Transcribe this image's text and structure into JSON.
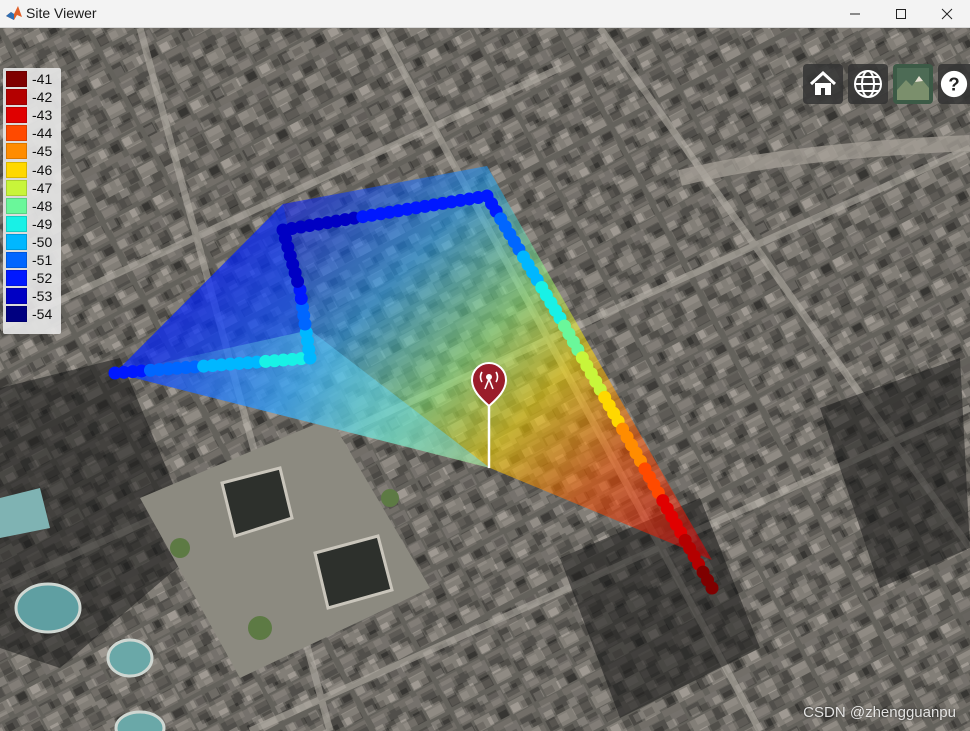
{
  "window": {
    "title": "Site Viewer"
  },
  "legend": {
    "items": [
      {
        "label": "-41",
        "color": "#7f0000"
      },
      {
        "label": "-42",
        "color": "#b40000"
      },
      {
        "label": "-43",
        "color": "#e00000"
      },
      {
        "label": "-44",
        "color": "#ff4a00"
      },
      {
        "label": "-45",
        "color": "#ff8c00"
      },
      {
        "label": "-46",
        "color": "#ffd800"
      },
      {
        "label": "-47",
        "color": "#c8f53a"
      },
      {
        "label": "-48",
        "color": "#6af79a"
      },
      {
        "label": "-49",
        "color": "#18f1e6"
      },
      {
        "label": "-50",
        "color": "#00b7ff"
      },
      {
        "label": "-51",
        "color": "#0066ff"
      },
      {
        "label": "-52",
        "color": "#0018ff"
      },
      {
        "label": "-53",
        "color": "#0000c4"
      },
      {
        "label": "-54",
        "color": "#000080"
      }
    ]
  },
  "toolbar": {
    "buttons": [
      {
        "name": "home-button",
        "icon": "home-icon"
      },
      {
        "name": "globe-button",
        "icon": "globe-icon"
      },
      {
        "name": "basemap-button",
        "icon": "terrain-thumbnail-icon"
      },
      {
        "name": "help-button",
        "icon": "question-icon"
      }
    ]
  },
  "site": {
    "icon": "antenna-marker-icon"
  },
  "watermark": {
    "text": "CSDN @zhengguanpu"
  }
}
